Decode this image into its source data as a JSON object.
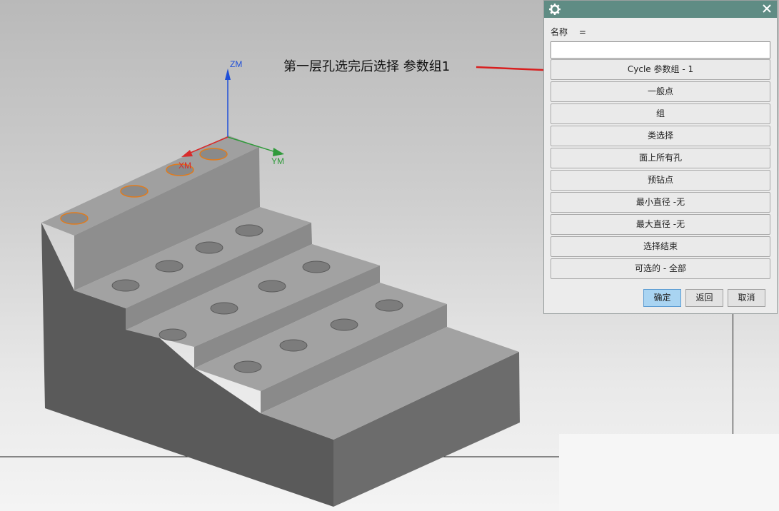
{
  "viewport": {
    "annotation": "第一层孔选完后选择  参数组1",
    "axes": {
      "z": "ZM",
      "x": "XM",
      "y": "YM"
    }
  },
  "dialog": {
    "name_label": "名称",
    "name_eq": "=",
    "name_value": "",
    "options": [
      "Cycle 参数组 - 1",
      "一般点",
      "组",
      "类选择",
      "面上所有孔",
      "预钻点",
      "最小直径 -无",
      "最大直径 -无",
      "选择结束",
      "可选的 - 全部"
    ],
    "ok_label": "确定",
    "back_label": "返回",
    "cancel_label": "取消"
  },
  "colors": {
    "titlebar": "#5f8c84",
    "selected_hole": "#e07b1d",
    "arrow": "#d81f1f",
    "axis_z": "#1f4fd8",
    "axis_x": "#d82b2b",
    "axis_y": "#2f9a3a"
  }
}
